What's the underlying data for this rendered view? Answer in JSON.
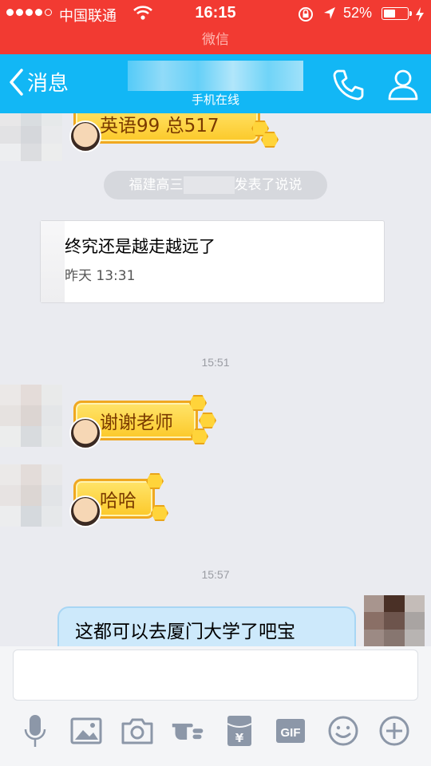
{
  "status_bar": {
    "carrier": "中国联通",
    "time": "16:15",
    "battery_percent": "52%",
    "battery_level": 0.52
  },
  "banner": {
    "text": "微信"
  },
  "nav": {
    "back_label": "消息",
    "subtitle": "手机在线"
  },
  "messages": {
    "bee1_text": "英语99  总517",
    "system_prefix": "福建高三",
    "system_suffix": "发表了说说",
    "card_text": "终究还是越走越远了",
    "card_time": "昨天 13:31",
    "time1": "15:51",
    "bee2_text": "谢谢老师",
    "bee3_text": "哈哈",
    "time2": "15:57",
    "mine_text": "这都可以去厦门大学了吧宝"
  },
  "toolbar": {
    "gif_label": "GIF",
    "yen_label": "¥"
  },
  "colors": {
    "status_red": "#f23a32",
    "nav_blue": "#12b7f5",
    "chat_bg": "#eaebf0"
  }
}
